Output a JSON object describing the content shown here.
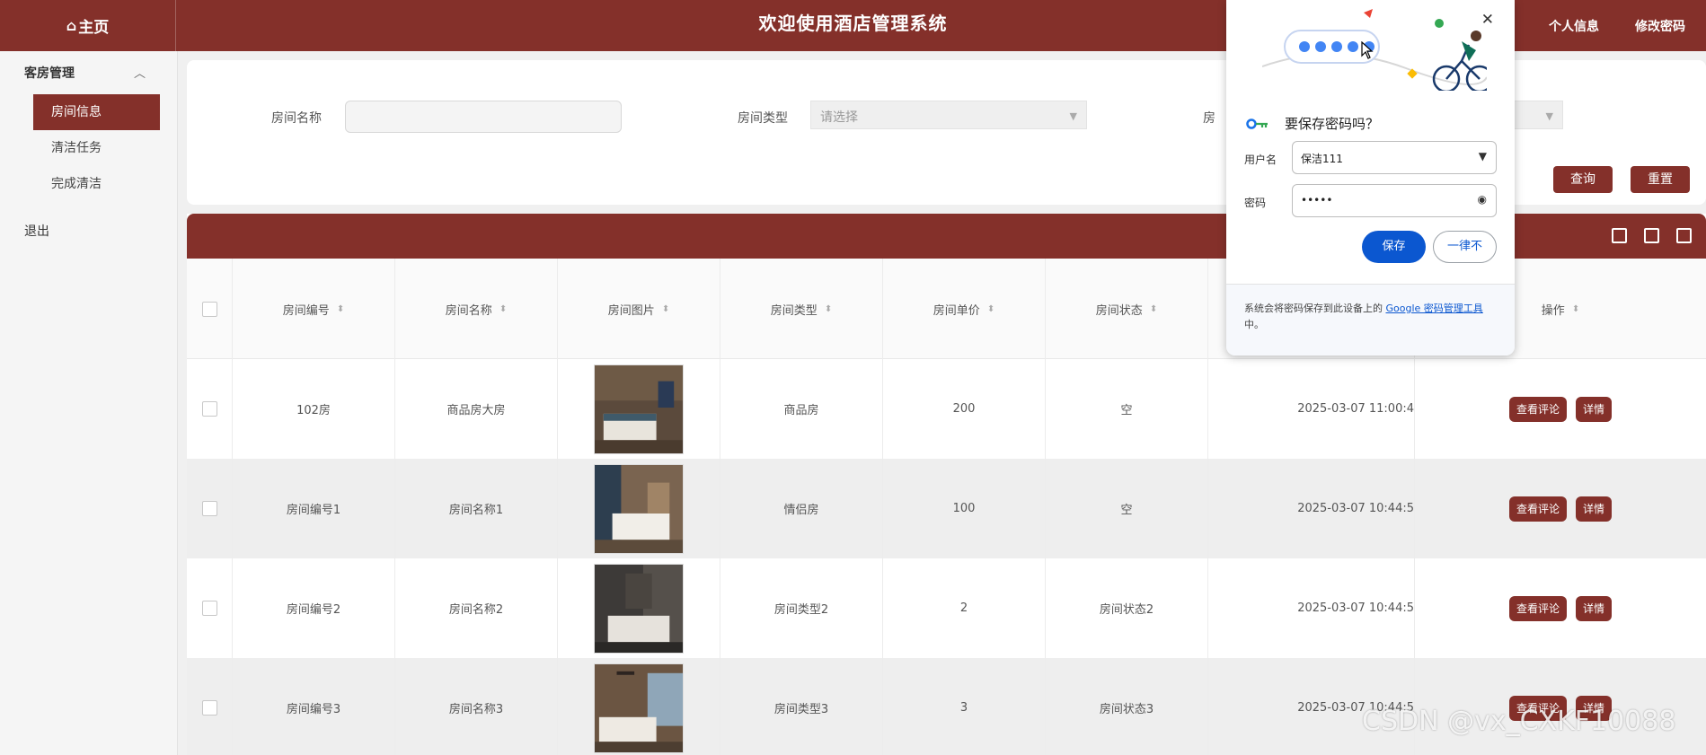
{
  "header": {
    "home_icon": "⌂",
    "home_label": "主页",
    "title": "欢迎使用酒店管理系统",
    "profile": "个人信息",
    "change_password": "修改密码"
  },
  "sidebar": {
    "group": "客房管理",
    "items": [
      "房间信息",
      "清洁任务",
      "完成清洁"
    ],
    "active_index": 0,
    "exit": "退出"
  },
  "search": {
    "room_name_label": "房间名称",
    "room_name_value": "",
    "room_type_label": "房间类型",
    "room_type_placeholder": "请选择",
    "room_status_label_partial": "房",
    "query_button": "查询",
    "reset_button": "重置"
  },
  "table": {
    "columns": [
      "房间编号",
      "房间名称",
      "房间图片",
      "房间类型",
      "房间单价",
      "房间状态",
      "",
      "操作"
    ],
    "rows": [
      {
        "number": "102房",
        "name": "商品房大房",
        "type": "商品房",
        "price": "200",
        "status": "空",
        "time": "2025-03-07 11:00:4"
      },
      {
        "number": "房间编号1",
        "name": "房间名称1",
        "type": "情侣房",
        "price": "100",
        "status": "空",
        "time": "2025-03-07 10:44:5"
      },
      {
        "number": "房间编号2",
        "name": "房间名称2",
        "type": "房间类型2",
        "price": "2",
        "status": "房间状态2",
        "time": "2025-03-07 10:44:5"
      },
      {
        "number": "房间编号3",
        "name": "房间名称3",
        "type": "房间类型3",
        "price": "3",
        "status": "房间状态3",
        "time": "2025-03-07 10:44:5"
      }
    ],
    "view_reviews_button": "查看评论",
    "detail_button": "详情"
  },
  "password_popup": {
    "title": "要保存密码吗？",
    "username_label": "用户名",
    "username_value": "保洁111",
    "password_label": "密码",
    "password_value": "•••••",
    "save_button": "保存",
    "never_button": "一律不",
    "footer_text": "系统会将密码保存到此设备上的",
    "footer_link": "Google 密码管理工具",
    "footer_end": "中。"
  },
  "watermark": "CSDN @vx_CXKF10088",
  "colors": {
    "brand": "#84302a",
    "google_blue": "#0b57d0"
  }
}
